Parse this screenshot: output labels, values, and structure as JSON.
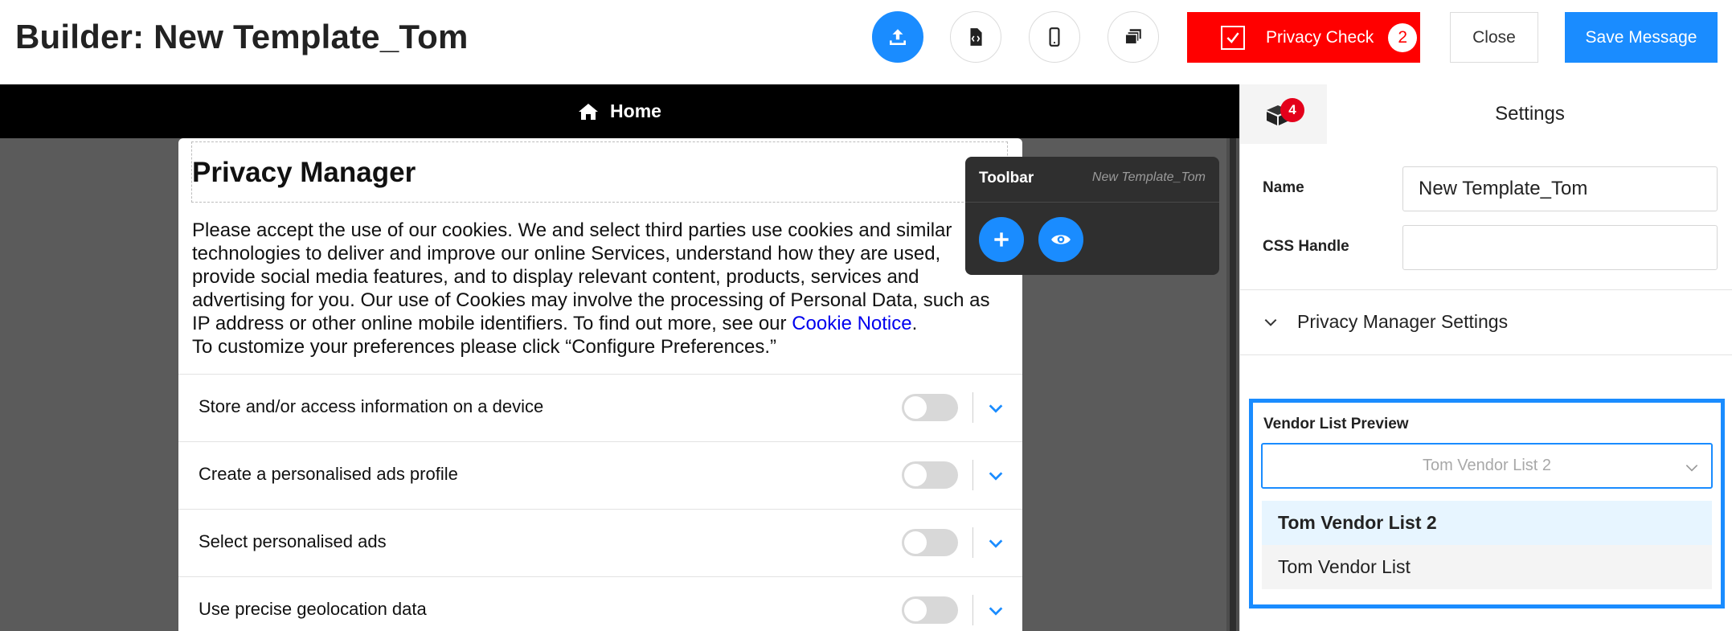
{
  "header": {
    "title": "Builder: New Template_Tom",
    "privacy_check_label": "Privacy Check",
    "privacy_check_count": "2",
    "close_label": "Close",
    "save_label": "Save Message",
    "icons": [
      "upload-icon",
      "code-file-icon",
      "mobile-icon",
      "layers-icon"
    ]
  },
  "canvas": {
    "nav_label": "Home",
    "card": {
      "title": "Privacy Manager",
      "body_lines": [
        "Please accept the use of our cookies. We and select third parties use cookies and similar",
        "technologies to deliver and improve our online Services, understand how they are used,",
        "provide social media features, and to display relevant content, products, services and",
        "advertising for you. Our use of Cookies may involve the processing of Personal Data, such as"
      ],
      "body_line5_pre": "IP address or other online mobile identifiers. To find out more, see our ",
      "cookie_link": "Cookie Notice",
      "body_line5_post": ".",
      "body_line6": "To customize your preferences please click “Configure Preferences.”",
      "purposes": [
        {
          "label": "Store and/or access information on a device"
        },
        {
          "label": "Create a personalised ads profile"
        },
        {
          "label": "Select personalised ads"
        },
        {
          "label": "Use precise geolocation data"
        }
      ]
    }
  },
  "toolbar": {
    "title": "Toolbar",
    "subtitle": "New Template_Tom"
  },
  "panel": {
    "badge_count": "4",
    "settings_tab": "Settings",
    "name_label": "Name",
    "name_value": "New Template_Tom",
    "css_label": "CSS Handle",
    "css_value": "",
    "accordion_label": "Privacy Manager Settings",
    "vendor_label": "Vendor List Preview",
    "vendor_selected": "Tom Vendor List 2",
    "vendor_options": [
      "Tom Vendor List 2",
      "Tom Vendor List"
    ]
  },
  "colors": {
    "accent": "#1a8cff",
    "privacy_check_bg": "#ff0000",
    "badge_red": "#e4001b",
    "canvas_bg": "#5b5b5b",
    "toolbar_bg": "#2f2f2f"
  }
}
